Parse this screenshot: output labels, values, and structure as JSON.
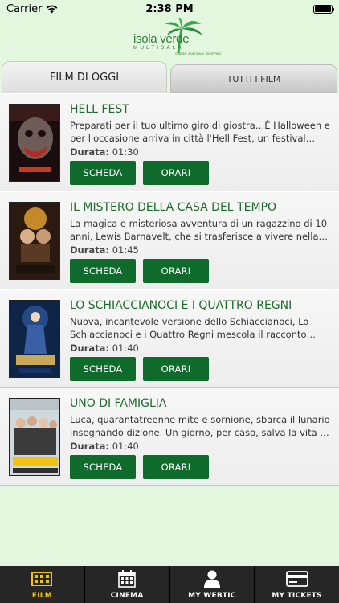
{
  "status": {
    "carrier": "Carrier",
    "time": "2:38 PM"
  },
  "logo": {
    "name": "isola verde",
    "sub": "MULTISALA",
    "tag": "CINEMA · MULTISALA · SHOPPING"
  },
  "tabs": {
    "active_label": "FILM DI OGGI",
    "inactive_label": "TUTTI I FILM"
  },
  "duration_label": "Durata:",
  "movies": [
    {
      "title": "HELL FEST",
      "description": "Preparati per il tuo ultimo giro di giostra…È Halloween e per l'occasione arriva in città l'Hell Fest, un festival itin…",
      "duration": "01:30",
      "scheda": "SCHEDA",
      "orari": "ORARI"
    },
    {
      "title": "IL MISTERO DELLA CASA DEL TEMPO",
      "description": "La magica e misteriosa avventura di un ragazzino di 10 anni, Lewis Barnavelt, che si trasferisce a vivere nella ca…",
      "duration": "01:45",
      "scheda": "SCHEDA",
      "orari": "ORARI"
    },
    {
      "title": "LO SCHIACCIANOCI E I QUATTRO REGNI",
      "description": "Nuova, incantevole versione dello Schiaccianoci, Lo Schiaccianoci e i Quattro Regni mescola il racconto fanta…",
      "duration": "01:40",
      "scheda": "SCHEDA",
      "orari": "ORARI"
    },
    {
      "title": "UNO DI FAMIGLIA",
      "description": "Luca, quarantatreenne mite e sornione, sbarca il lunario insegnando dizione. Un giorno, per caso, salva la vita al s…",
      "duration": "01:40",
      "scheda": "SCHEDA",
      "orari": "ORARI"
    }
  ],
  "tabbar": [
    {
      "label": "FILM",
      "icon": "film-icon"
    },
    {
      "label": "CINEMA",
      "icon": "calendar-icon"
    },
    {
      "label": "MY WEBTIC",
      "icon": "user-icon"
    },
    {
      "label": "MY TICKETS",
      "icon": "card-icon"
    }
  ],
  "colors": {
    "background": "#e3f7df",
    "accent_green": "#0f6b2c",
    "title_green": "#1f6b2b",
    "tabbar_bg": "#262626",
    "tabbar_active": "#f5c400"
  }
}
